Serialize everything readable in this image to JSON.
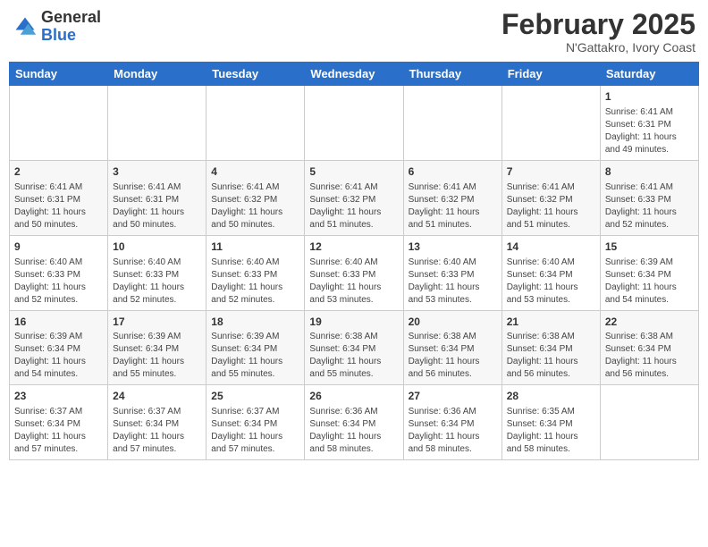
{
  "header": {
    "logo_general": "General",
    "logo_blue": "Blue",
    "month": "February 2025",
    "location": "N'Gattakro, Ivory Coast"
  },
  "days_of_week": [
    "Sunday",
    "Monday",
    "Tuesday",
    "Wednesday",
    "Thursday",
    "Friday",
    "Saturday"
  ],
  "weeks": [
    [
      {
        "day": "",
        "content": ""
      },
      {
        "day": "",
        "content": ""
      },
      {
        "day": "",
        "content": ""
      },
      {
        "day": "",
        "content": ""
      },
      {
        "day": "",
        "content": ""
      },
      {
        "day": "",
        "content": ""
      },
      {
        "day": "1",
        "content": "Sunrise: 6:41 AM\nSunset: 6:31 PM\nDaylight: 11 hours and 49 minutes."
      }
    ],
    [
      {
        "day": "2",
        "content": "Sunrise: 6:41 AM\nSunset: 6:31 PM\nDaylight: 11 hours and 50 minutes."
      },
      {
        "day": "3",
        "content": "Sunrise: 6:41 AM\nSunset: 6:31 PM\nDaylight: 11 hours and 50 minutes."
      },
      {
        "day": "4",
        "content": "Sunrise: 6:41 AM\nSunset: 6:32 PM\nDaylight: 11 hours and 50 minutes."
      },
      {
        "day": "5",
        "content": "Sunrise: 6:41 AM\nSunset: 6:32 PM\nDaylight: 11 hours and 51 minutes."
      },
      {
        "day": "6",
        "content": "Sunrise: 6:41 AM\nSunset: 6:32 PM\nDaylight: 11 hours and 51 minutes."
      },
      {
        "day": "7",
        "content": "Sunrise: 6:41 AM\nSunset: 6:32 PM\nDaylight: 11 hours and 51 minutes."
      },
      {
        "day": "8",
        "content": "Sunrise: 6:41 AM\nSunset: 6:33 PM\nDaylight: 11 hours and 52 minutes."
      }
    ],
    [
      {
        "day": "9",
        "content": "Sunrise: 6:40 AM\nSunset: 6:33 PM\nDaylight: 11 hours and 52 minutes."
      },
      {
        "day": "10",
        "content": "Sunrise: 6:40 AM\nSunset: 6:33 PM\nDaylight: 11 hours and 52 minutes."
      },
      {
        "day": "11",
        "content": "Sunrise: 6:40 AM\nSunset: 6:33 PM\nDaylight: 11 hours and 52 minutes."
      },
      {
        "day": "12",
        "content": "Sunrise: 6:40 AM\nSunset: 6:33 PM\nDaylight: 11 hours and 53 minutes."
      },
      {
        "day": "13",
        "content": "Sunrise: 6:40 AM\nSunset: 6:33 PM\nDaylight: 11 hours and 53 minutes."
      },
      {
        "day": "14",
        "content": "Sunrise: 6:40 AM\nSunset: 6:34 PM\nDaylight: 11 hours and 53 minutes."
      },
      {
        "day": "15",
        "content": "Sunrise: 6:39 AM\nSunset: 6:34 PM\nDaylight: 11 hours and 54 minutes."
      }
    ],
    [
      {
        "day": "16",
        "content": "Sunrise: 6:39 AM\nSunset: 6:34 PM\nDaylight: 11 hours and 54 minutes."
      },
      {
        "day": "17",
        "content": "Sunrise: 6:39 AM\nSunset: 6:34 PM\nDaylight: 11 hours and 55 minutes."
      },
      {
        "day": "18",
        "content": "Sunrise: 6:39 AM\nSunset: 6:34 PM\nDaylight: 11 hours and 55 minutes."
      },
      {
        "day": "19",
        "content": "Sunrise: 6:38 AM\nSunset: 6:34 PM\nDaylight: 11 hours and 55 minutes."
      },
      {
        "day": "20",
        "content": "Sunrise: 6:38 AM\nSunset: 6:34 PM\nDaylight: 11 hours and 56 minutes."
      },
      {
        "day": "21",
        "content": "Sunrise: 6:38 AM\nSunset: 6:34 PM\nDaylight: 11 hours and 56 minutes."
      },
      {
        "day": "22",
        "content": "Sunrise: 6:38 AM\nSunset: 6:34 PM\nDaylight: 11 hours and 56 minutes."
      }
    ],
    [
      {
        "day": "23",
        "content": "Sunrise: 6:37 AM\nSunset: 6:34 PM\nDaylight: 11 hours and 57 minutes."
      },
      {
        "day": "24",
        "content": "Sunrise: 6:37 AM\nSunset: 6:34 PM\nDaylight: 11 hours and 57 minutes."
      },
      {
        "day": "25",
        "content": "Sunrise: 6:37 AM\nSunset: 6:34 PM\nDaylight: 11 hours and 57 minutes."
      },
      {
        "day": "26",
        "content": "Sunrise: 6:36 AM\nSunset: 6:34 PM\nDaylight: 11 hours and 58 minutes."
      },
      {
        "day": "27",
        "content": "Sunrise: 6:36 AM\nSunset: 6:34 PM\nDaylight: 11 hours and 58 minutes."
      },
      {
        "day": "28",
        "content": "Sunrise: 6:35 AM\nSunset: 6:34 PM\nDaylight: 11 hours and 58 minutes."
      },
      {
        "day": "",
        "content": ""
      }
    ]
  ]
}
